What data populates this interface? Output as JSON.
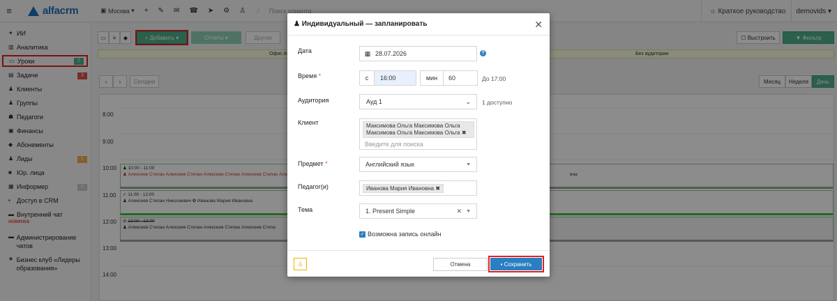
{
  "topbar": {
    "menu_icon": "hamburger-icon",
    "logo_text": "alfacrm",
    "city": "Москва",
    "search_placeholder": "Поиск клиента",
    "guide_label": "Краткое руководство",
    "username": "demovids"
  },
  "sidebar": {
    "items": [
      {
        "label": "ИИ",
        "icon": "sparkle-icon"
      },
      {
        "label": "Аналитика",
        "icon": "chart-icon"
      },
      {
        "label": "Уроки",
        "icon": "calendar-icon",
        "badge": "2"
      },
      {
        "label": "Задачи",
        "icon": "tasks-icon",
        "badge": "3"
      },
      {
        "label": "Клиенты",
        "icon": "user-icon"
      },
      {
        "label": "Группы",
        "icon": "group-icon"
      },
      {
        "label": "Педагоги",
        "icon": "teacher-icon"
      },
      {
        "label": "Финансы",
        "icon": "money-icon"
      },
      {
        "label": "Абонементы",
        "icon": "tag-icon"
      },
      {
        "label": "Лиды",
        "icon": "leads-icon",
        "badge": "1"
      },
      {
        "label": "Юр. лица",
        "icon": "briefcase-icon"
      },
      {
        "label": "Информер",
        "icon": "informer-icon",
        "badge": "0"
      },
      {
        "label": "Доступ в CRM",
        "icon": "lock-icon"
      },
      {
        "label": "Внутренний чат",
        "icon": "chat-icon",
        "sublabel": "новинка"
      },
      {
        "label": "Администрирование чатов",
        "icon": "admin-chat-icon"
      },
      {
        "label": "Бизнес клуб «Лидеры образования»",
        "icon": "star-icon"
      }
    ]
  },
  "toolbar": {
    "add_label": "+ Добавить ▾",
    "reports_label": "Отчеты ▾",
    "other_label": "Другие",
    "build_label": "Выстроить",
    "filter_label": "Фильтр",
    "office_label": "Офис Ау",
    "no_room_label": "Без аудитории",
    "today_label": "Сегодня",
    "view_month": "Месяц",
    "view_week": "Неделя",
    "view_day": "День"
  },
  "schedule": {
    "times": [
      "8:00",
      "9:00",
      "10:00",
      "11:00",
      "12:00",
      "13:00",
      "14:00"
    ],
    "lessons": [
      {
        "time": "10:00 - 11:00",
        "people": "Алексеев Степан Алексеев Степан Алексеев Степан Алексеев Степан Алексеев Степа",
        "tail": "вна"
      },
      {
        "time": "11:00 - 12:00",
        "people": "Алексеев Степан Николаевич ✿ Иванова Мария Ивановна"
      },
      {
        "time": "12:00 - 13:00",
        "people": "Алексеев Степан Алексеев Степан Алексеев Степан Алексеев Степа"
      }
    ]
  },
  "modal": {
    "title": "Индивидуальный — запланировать",
    "date_label": "Дата",
    "date_value": "28.07.2026",
    "time_label": "Время",
    "time_from_prefix": "с",
    "time_from": "16:00",
    "min_label": "мин",
    "duration": "60",
    "until": "До 17:00",
    "room_label": "Аудитория",
    "room_value": "Ауд 1",
    "room_hint": "1 доступно",
    "client_label": "Клиент",
    "client_tag_line1": "Максимова Ольга Максимова Ольга",
    "client_tag_line2": "Максимова Ольга Максимова Ольга",
    "client_placeholder": "Введите для поиска",
    "subject_label": "Предмет",
    "subject_value": "Английский язык",
    "teacher_label": "Педагог(и)",
    "teacher_value": "Иванова Мария Ивановна",
    "topic_label": "Тема",
    "topic_value": "1. Present Simple",
    "online_label": "Возможна запись онлайн",
    "cancel_label": "Отмена",
    "save_label": "Сохранить"
  }
}
